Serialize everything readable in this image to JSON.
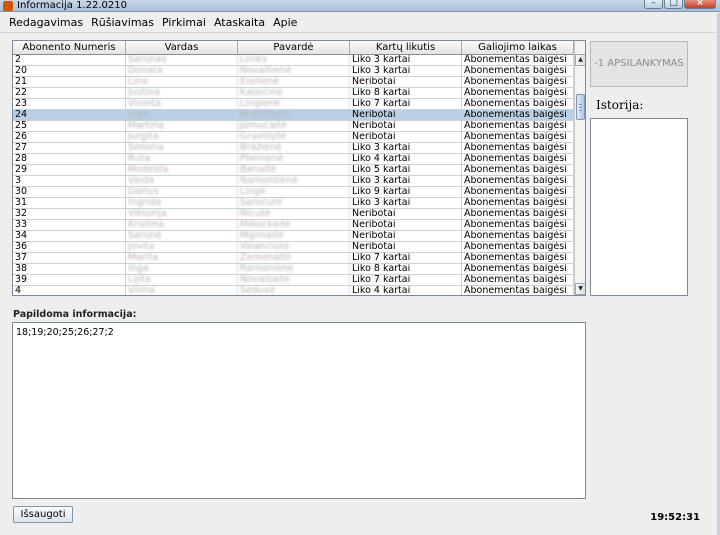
{
  "window": {
    "title": "Informacija 1.22.0210",
    "controls": {
      "minimize": "–",
      "maximize": "□",
      "close": "×"
    }
  },
  "menu": [
    "Redagavimas",
    "Rūšiavimas",
    "Pirkimai",
    "Ataskaita",
    "Apie"
  ],
  "table": {
    "headers": [
      "Abonento Numeris",
      "Vardas",
      "Pavardė",
      "Kartų likutis",
      "Galiojimo laikas"
    ],
    "selected_index": 5,
    "rows": [
      [
        "2",
        "Šarūnas",
        "Liniks",
        "Liko 3 kartai",
        "Abonementas baigėsi"
      ],
      [
        "20",
        "Donata",
        "Novaitienė",
        "Liko 3 kartai",
        "Abonementas baigėsi"
      ],
      [
        "21",
        "Lina",
        "Eisilienė",
        "Neribotai",
        "Abonementas baigėsi"
      ],
      [
        "22",
        "Justina",
        "Kalaicinė",
        "Liko 8 kartai",
        "Abonementas baigėsi"
      ],
      [
        "23",
        "Violeta",
        "Lingienė",
        "Liko 7 kartai",
        "Abonementas baigėsi"
      ],
      [
        "24",
        "Ingė",
        "Brazdžiutė",
        "Neribotai",
        "Abonementas baigėsi"
      ],
      [
        "25",
        "Martina",
        "Jomučaitė",
        "Neribotai",
        "Abonementas baigėsi"
      ],
      [
        "26",
        "Jurgita",
        "Grainilytė",
        "Neribotai",
        "Abonementas baigėsi"
      ],
      [
        "27",
        "Simona",
        "Bražienė",
        "Liko 3 kartai",
        "Abonementas baigėsi"
      ],
      [
        "28",
        "Rūta",
        "Plienienė",
        "Liko 4 kartai",
        "Abonementas baigėsi"
      ],
      [
        "29",
        "Modesta",
        "Banaitė",
        "Liko 5 kartai",
        "Abonementas baigėsi"
      ],
      [
        "3",
        "Vaida",
        "Namontienė",
        "Liko 3 kartai",
        "Abonementas baigėsi"
      ],
      [
        "30",
        "Darius",
        "Lingė",
        "Liko 9 kartai",
        "Abonementas baigėsi"
      ],
      [
        "31",
        "Ingrida",
        "Saročutė",
        "Liko 3 kartai",
        "Abonementas baigėsi"
      ],
      [
        "32",
        "Viktorija",
        "Nicutė",
        "Neribotai",
        "Abonementas baigėsi"
      ],
      [
        "33",
        "Kristina",
        "Mikuckaitė",
        "Neribotai",
        "Abonementas baigėsi"
      ],
      [
        "34",
        "Šarūnė",
        "Mgimaitė",
        "Neribotai",
        "Abonementas baigėsi"
      ],
      [
        "36",
        "Jovita",
        "Valančiūtė",
        "Neribotai",
        "Abonementas baigėsi"
      ],
      [
        "37",
        "Marita",
        "Žemonaitė",
        "Liko 7 kartai",
        "Abonementas baigėsi"
      ],
      [
        "38",
        "Inga",
        "Ramonienė",
        "Liko 8 kartai",
        "Abonementas baigėsi"
      ],
      [
        "39",
        "Lijita",
        "Novaišaitė",
        "Liko 7 kartai",
        "Abonementas baigėsi"
      ],
      [
        "4",
        "Vilma",
        "Šeduvė",
        "Liko 4 kartai",
        "Abonementas baigėsi"
      ]
    ]
  },
  "side": {
    "visit_button": "-1 APSILANKYMAS",
    "history_label": "Istorija:"
  },
  "extra": {
    "label": "Papildoma informacija:",
    "value": "18;19;20;25;26;27;2"
  },
  "footer": {
    "save_label": "Išsaugoti",
    "clock": "19:52:31"
  }
}
